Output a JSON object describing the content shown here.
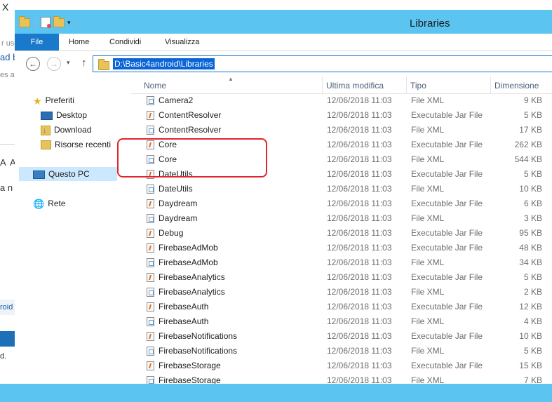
{
  "background_window": {
    "glyph": "X",
    "fragments": [
      "r use",
      "ad b",
      "es ag",
      "A",
      "A",
      "a n",
      "roid",
      "d."
    ]
  },
  "window": {
    "title": "Libraries",
    "qat_arrow": "▾"
  },
  "ribbon": {
    "tabs": [
      "File",
      "Home",
      "Condividi",
      "Visualizza"
    ]
  },
  "address": {
    "path": "D:\\Basic4android\\Libraries",
    "back_glyph": "←",
    "forward_glyph": "→",
    "recent_glyph": "▾",
    "up_glyph": "↑"
  },
  "nav": {
    "favorites": "Preferiti",
    "desktop": "Desktop",
    "download": "Download",
    "recent": "Risorse recenti",
    "thispc": "Questo PC",
    "network": "Rete",
    "star_glyph": "★",
    "net_glyph": "🌐"
  },
  "columns": {
    "name": "Nome",
    "date": "Ultima modifica",
    "type": "Tipo",
    "size": "Dimensione",
    "sort_glyph": "▲"
  },
  "files": [
    {
      "name": "Camera2",
      "date": "12/06/2018 11:03",
      "type": "File XML",
      "size": "9 KB",
      "icon": "xml"
    },
    {
      "name": "ContentResolver",
      "date": "12/06/2018 11:03",
      "type": "Executable Jar File",
      "size": "5 KB",
      "icon": "jar"
    },
    {
      "name": "ContentResolver",
      "date": "12/06/2018 11:03",
      "type": "File XML",
      "size": "17 KB",
      "icon": "xml"
    },
    {
      "name": "Core",
      "date": "12/06/2018 11:03",
      "type": "Executable Jar File",
      "size": "262 KB",
      "icon": "jar"
    },
    {
      "name": "Core",
      "date": "12/06/2018 11:03",
      "type": "File XML",
      "size": "544 KB",
      "icon": "xml"
    },
    {
      "name": "DateUtils",
      "date": "12/06/2018 11:03",
      "type": "Executable Jar File",
      "size": "5 KB",
      "icon": "jar"
    },
    {
      "name": "DateUtils",
      "date": "12/06/2018 11:03",
      "type": "File XML",
      "size": "10 KB",
      "icon": "xml"
    },
    {
      "name": "Daydream",
      "date": "12/06/2018 11:03",
      "type": "Executable Jar File",
      "size": "6 KB",
      "icon": "jar"
    },
    {
      "name": "Daydream",
      "date": "12/06/2018 11:03",
      "type": "File XML",
      "size": "3 KB",
      "icon": "xml"
    },
    {
      "name": "Debug",
      "date": "12/06/2018 11:03",
      "type": "Executable Jar File",
      "size": "95 KB",
      "icon": "jar"
    },
    {
      "name": "FirebaseAdMob",
      "date": "12/06/2018 11:03",
      "type": "Executable Jar File",
      "size": "48 KB",
      "icon": "jar"
    },
    {
      "name": "FirebaseAdMob",
      "date": "12/06/2018 11:03",
      "type": "File XML",
      "size": "34 KB",
      "icon": "xml"
    },
    {
      "name": "FirebaseAnalytics",
      "date": "12/06/2018 11:03",
      "type": "Executable Jar File",
      "size": "5 KB",
      "icon": "jar"
    },
    {
      "name": "FirebaseAnalytics",
      "date": "12/06/2018 11:03",
      "type": "File XML",
      "size": "2 KB",
      "icon": "xml"
    },
    {
      "name": "FirebaseAuth",
      "date": "12/06/2018 11:03",
      "type": "Executable Jar File",
      "size": "12 KB",
      "icon": "jar"
    },
    {
      "name": "FirebaseAuth",
      "date": "12/06/2018 11:03",
      "type": "File XML",
      "size": "4 KB",
      "icon": "xml"
    },
    {
      "name": "FirebaseNotifications",
      "date": "12/06/2018 11:03",
      "type": "Executable Jar File",
      "size": "10 KB",
      "icon": "jar"
    },
    {
      "name": "FirebaseNotifications",
      "date": "12/06/2018 11:03",
      "type": "File XML",
      "size": "5 KB",
      "icon": "xml"
    },
    {
      "name": "FirebaseStorage",
      "date": "12/06/2018 11:03",
      "type": "Executable Jar File",
      "size": "15 KB",
      "icon": "jar"
    },
    {
      "name": "FirebaseStorage",
      "date": "12/06/2018 11:03",
      "type": "File XML",
      "size": "7 KB",
      "icon": "xml"
    }
  ],
  "colors": {
    "titlebar": "#5bc4f0",
    "file_tab": "#1979ca",
    "address_selection": "#0a64d6",
    "highlight": "#e0242b",
    "nav_selected": "#cce8ff"
  }
}
